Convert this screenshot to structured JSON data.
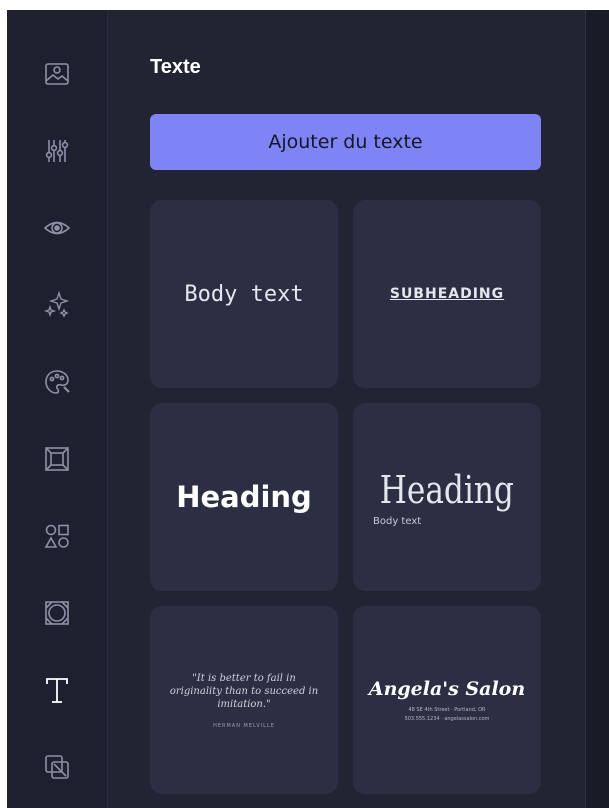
{
  "panel": {
    "title": "Texte",
    "add_text_label": "Ajouter du texte"
  },
  "toolbar": {
    "items": [
      {
        "name": "image-icon"
      },
      {
        "name": "adjustments-icon"
      },
      {
        "name": "eye-icon"
      },
      {
        "name": "sparkles-icon"
      },
      {
        "name": "palette-icon"
      },
      {
        "name": "frame-icon"
      },
      {
        "name": "shapes-icon"
      },
      {
        "name": "texture-icon"
      },
      {
        "name": "text-icon",
        "active": true
      },
      {
        "name": "layers-icon"
      }
    ]
  },
  "presets": {
    "body_text": "Body text",
    "subheading": "SUBHEADING",
    "heading_sans": "Heading",
    "heading_serif": "Heading",
    "heading_serif_body": "Body text",
    "quote": "\"It is better to fail in originality than to succeed in imitation.\"",
    "quote_author": "HERMAN MELVILLE",
    "salon_name": "Angela's Salon",
    "salon_address": "48 SE 4th Street · Portland, OR",
    "salon_contact": "503.555.1234 · angelassalon.com"
  },
  "colors": {
    "accent": "#7f84f5",
    "panel_bg": "#222434",
    "card_bg": "#2c2f43"
  }
}
